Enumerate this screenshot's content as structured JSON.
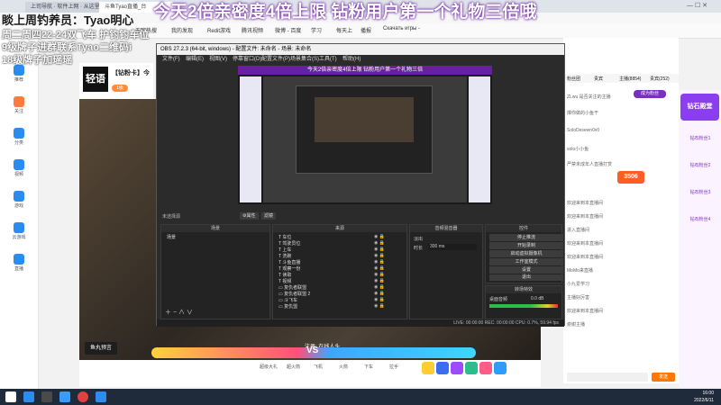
{
  "browser": {
    "tabs": [
      "上司导航 · 软件上网 · 从这里开始",
      "斗鱼Tyao直播_台",
      ""
    ],
    "bookmarks": [
      "无聊热搜",
      "我的发现",
      "Redit游戏",
      "腾讯视频",
      "微博 - 百度",
      "直播回放",
      "鼠标 软件",
      "学习",
      "每天上",
      "播报",
      "国内",
      "搜索 高清",
      "学习频道",
      "Скачать игры -"
    ]
  },
  "overlay": {
    "headline": "今天2倍亲密度4倍上限 钻粉用户第一个礼物三倍哦",
    "line1": "睒上周钓养员：Tyao明心",
    "line2": "周二周四22-24双飞车 护钓钓车位",
    "line3": "9级牌子进群联系Tyao二维码i",
    "line4": "18级牌子加瑶瑶"
  },
  "sidebar": {
    "items": [
      "推荐",
      "关注",
      "分类",
      "视频",
      "游戏",
      "云游戏",
      "直播"
    ]
  },
  "streamer": {
    "name": "【钻粉卡】今",
    "brand": "轻语",
    "badge": "1级"
  },
  "obs": {
    "title": "OBS 27.2.3 (64-bit, windows) - 配置文件: 未命名 - 场景: 未命名",
    "menu": [
      "文件(F)",
      "编辑(E)",
      "视图(V)",
      "停靠窗口(D)",
      "配置文件(P)",
      "场景集合(S)",
      "工具(T)",
      "帮助(H)"
    ],
    "preview_overlay": "今天2倍亲密度4倍上限 钻粉用户第一个礼物三倍",
    "source_label": "未选择源",
    "props_btn": "属性",
    "filters_btn": "滤镜",
    "panels": {
      "scenes": "场景",
      "sources": "来源",
      "mixer": "音频混音器",
      "transitions": "转场特效",
      "controls": "控件"
    },
    "scene_items": [
      "场景"
    ],
    "sources": [
      "车位",
      "驾驶员位",
      "上车",
      "洗碗",
      "斗鱼直播",
      "观察一份",
      "读取",
      "视频",
      "复仇者联盟",
      "复仇者联盟 2",
      "斗飞车",
      "复仇盟"
    ],
    "transition": "淡出",
    "duration_label": "时长",
    "duration_value": "300 ms",
    "controls": [
      "停止推流",
      "开始录制",
      "启动虚拟摄像机",
      "工作室模式",
      "设置",
      "退出"
    ],
    "audio_label": "桌面音频",
    "audio_level": "0.0 dB",
    "status": "LIVE: 00:00:00   REC: 00:00:00   CPU: 0.7%, 59.94 fps"
  },
  "stream": {
    "bottom_title": "注册: 在线人头",
    "show_btn": "鱼丸预言"
  },
  "right_panel": {
    "tabs": [
      "粉丝团",
      "贵宾",
      "主播(8854)",
      "贵宾(252)"
    ],
    "chat": [
      "ZLwu 是否关注的主播",
      "撑你做的小鱼干",
      "SoloDesewn0v0",
      "solo小小鱼",
      "严禁未成年人直播打赏",
      "欢迎来到本直播间",
      "欢迎来到本直播间",
      "进入直播间",
      "欢迎来到本直播间",
      "欢迎来到本直播间",
      "MoMo来直播",
      "小九爱学习",
      "主播好厉害",
      "欢迎来到本直播间",
      "谢谢主播"
    ],
    "follow_btn": "成为粉丝",
    "send_btn": "发送",
    "follow_count": "3506"
  },
  "gifts_col": {
    "title": "钻石殿堂",
    "items": [
      "钻石粉丝1",
      "钻石粉丝2",
      "钻石粉丝3",
      "钻石粉丝4"
    ]
  },
  "gift_bar": {
    "labels": [
      "超级大礼",
      "超火箭",
      "飞机",
      "火箭",
      "下车",
      "拉手"
    ],
    "pk_text": "VS"
  },
  "taskbar": {
    "time": "16:00",
    "date": "2022/6/11"
  },
  "colors": {
    "accent": "#ff5d23",
    "purple": "#7b2fbf",
    "douyu_orange": "#ff7700"
  }
}
